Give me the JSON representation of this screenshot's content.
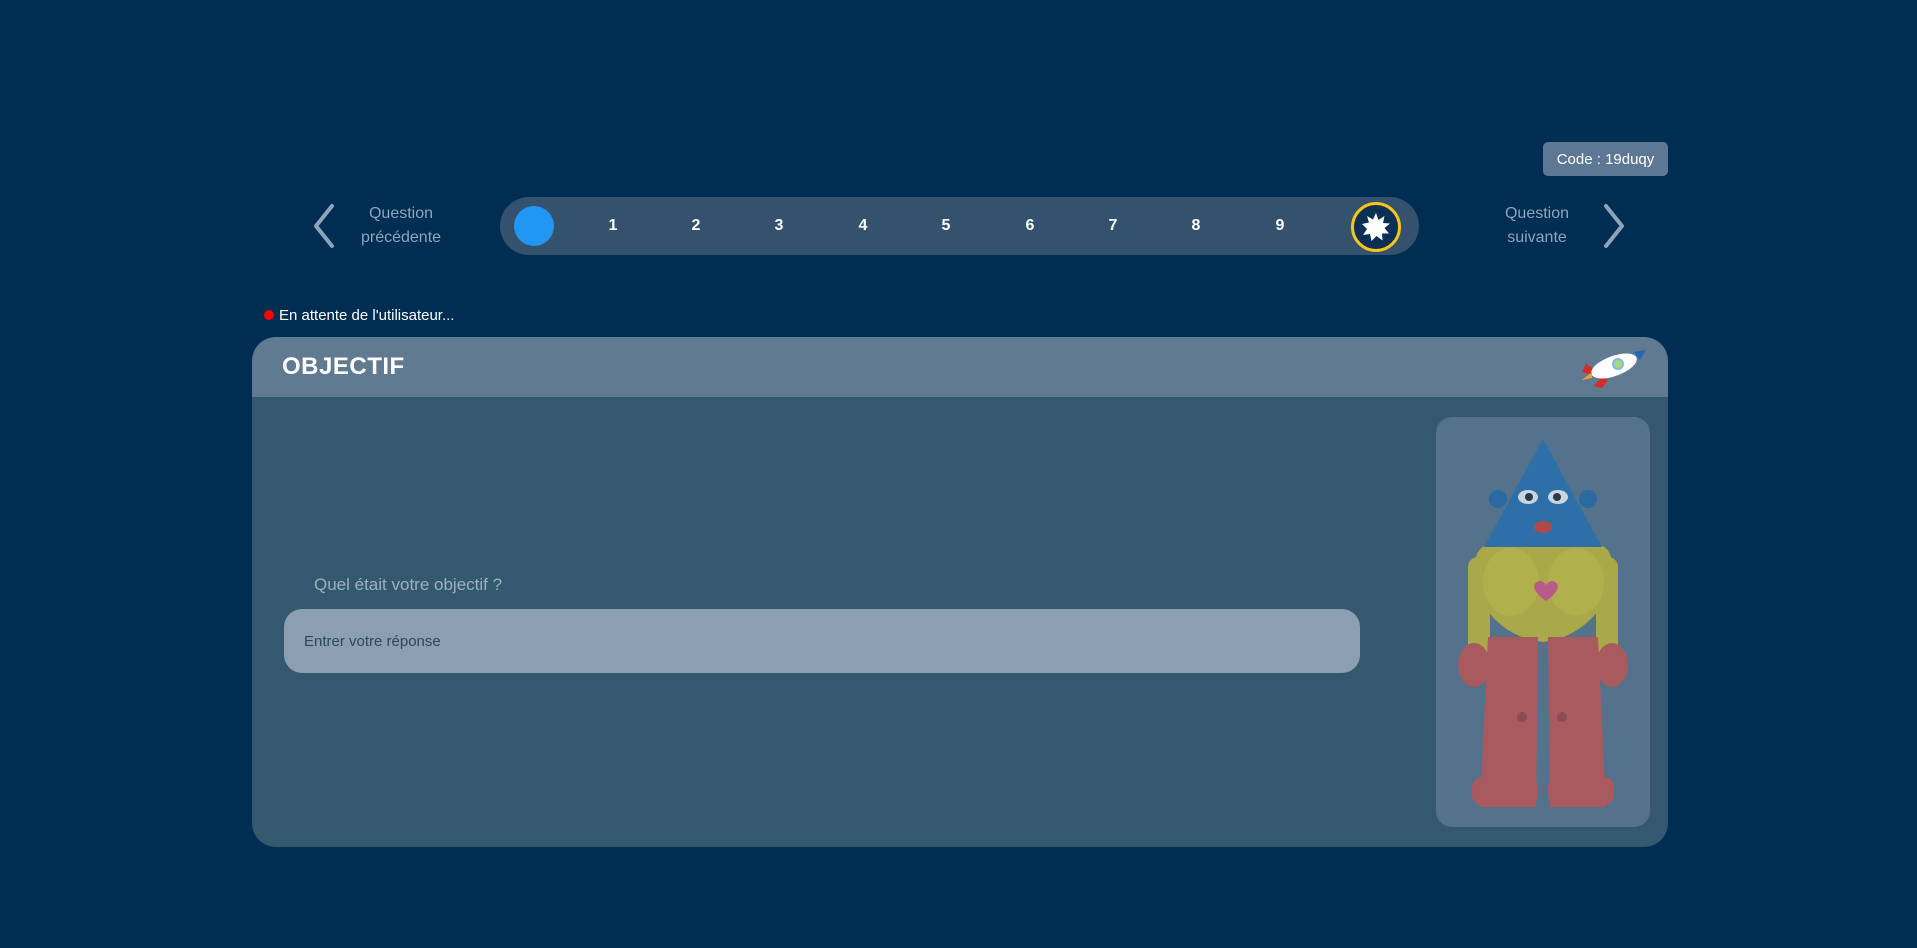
{
  "code_badge": {
    "text": "Code : 19duqy"
  },
  "navigation": {
    "previous_line1": "Question",
    "previous_line2": "précédente",
    "next_line1": "Question",
    "next_line2": "suivante"
  },
  "progress": {
    "current_step": 0,
    "steps": [
      "1",
      "2",
      "3",
      "4",
      "5",
      "6",
      "7",
      "8",
      "9"
    ],
    "colors": {
      "current": "#2196f3",
      "final_ring": "#f5c518"
    },
    "final_icon": "starburst-icon"
  },
  "status": {
    "text": "En attente de l'utilisateur...",
    "color": "#ff0000"
  },
  "card": {
    "title": "OBJECTIF",
    "icon": "rocket-icon",
    "question": "Quel était votre objectif ?",
    "input_placeholder": "Entrer votre réponse",
    "input_value": ""
  },
  "avatar": {
    "icon": "robot-character-illustration"
  }
}
